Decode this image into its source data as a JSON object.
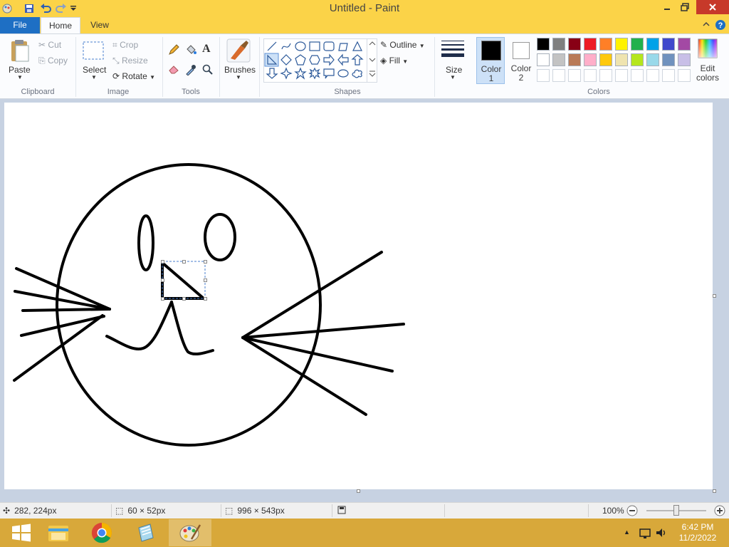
{
  "window": {
    "title": "Untitled - Paint"
  },
  "tabs": {
    "file": "File",
    "home": "Home",
    "view": "View"
  },
  "clipboard": {
    "paste": "Paste",
    "cut": "Cut",
    "copy": "Copy",
    "label": "Clipboard"
  },
  "image": {
    "select": "Select",
    "crop": "Crop",
    "resize": "Resize",
    "rotate": "Rotate",
    "label": "Image"
  },
  "tools": {
    "label": "Tools",
    "text_glyph": "A"
  },
  "brushes": {
    "label": "Brushes"
  },
  "shapes": {
    "outline": "Outline",
    "fill": "Fill",
    "label": "Shapes"
  },
  "size": {
    "label": "Size"
  },
  "colors": {
    "color1_line1": "Color",
    "color1_line2": "1",
    "color2_line1": "Color",
    "color2_line2": "2",
    "edit_line1": "Edit",
    "edit_line2": "colors",
    "label": "Colors",
    "color1": "#000000",
    "color2": "#ffffff",
    "palette_row1": [
      "#000000",
      "#7f7f7f",
      "#880015",
      "#ed1c24",
      "#ff7f27",
      "#fff200",
      "#22b14c",
      "#00a2e8",
      "#3f48cc",
      "#a349a4"
    ],
    "palette_row2": [
      "#ffffff",
      "#c3c3c3",
      "#b97a57",
      "#ffaec9",
      "#ffc90e",
      "#efe4b0",
      "#b5e61d",
      "#99d9ea",
      "#7092be",
      "#c8bfe7"
    ]
  },
  "status": {
    "cursor_pos": "282, 224px",
    "selection_size": "60 × 52px",
    "canvas_size": "996 × 543px",
    "zoom": "100%"
  },
  "taskbar": {
    "time": "6:42 PM",
    "date": "11/2/2022"
  }
}
